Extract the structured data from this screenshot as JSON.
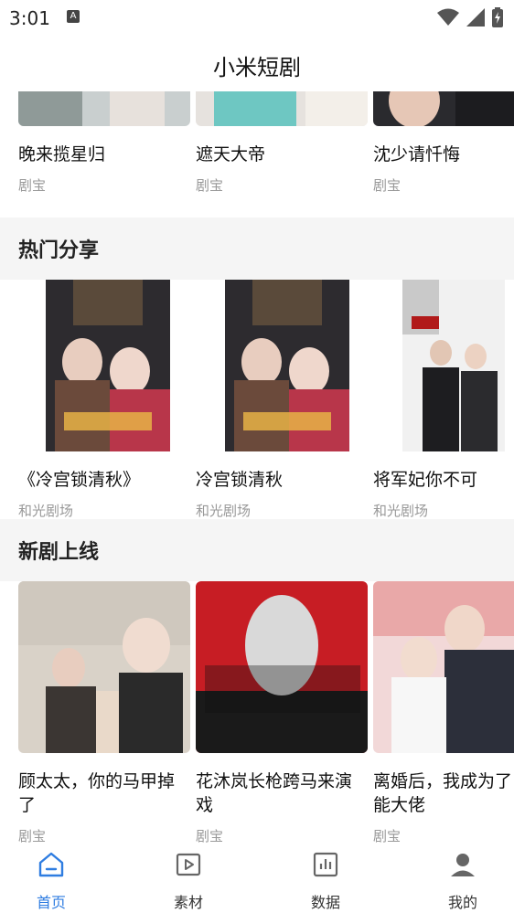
{
  "status_bar": {
    "time": "3:01"
  },
  "header": {
    "title": "小米短剧"
  },
  "top_row": [
    {
      "title": "晚来揽星归",
      "source": "剧宝"
    },
    {
      "title": "遮天大帝",
      "source": "剧宝"
    },
    {
      "title": "沈少请忏悔",
      "source": "剧宝"
    }
  ],
  "hot_share": {
    "title": "热门分享",
    "items": [
      {
        "title": "《冷宫锁清秋》",
        "source": "和光剧场"
      },
      {
        "title": "冷宫锁清秋",
        "source": "和光剧场"
      },
      {
        "title": "将军妃你不可",
        "source": "和光剧场"
      }
    ]
  },
  "new_release": {
    "title": "新剧上线",
    "items": [
      {
        "title_line1": "顾太太，你的马甲掉",
        "title_line2": "了",
        "source": "剧宝"
      },
      {
        "title_line1": "花沐岚长枪跨马来演",
        "title_line2": "戏",
        "source": "剧宝"
      },
      {
        "title_line1": "离婚后，我成为了",
        "title_line2": "能大佬",
        "source": "剧宝"
      }
    ]
  },
  "bottom_nav": [
    {
      "label": "首页",
      "icon": "home-icon",
      "active": true
    },
    {
      "label": "素材",
      "icon": "play-box-icon",
      "active": false
    },
    {
      "label": "数据",
      "icon": "bar-chart-icon",
      "active": false
    },
    {
      "label": "我的",
      "icon": "user-icon",
      "active": false
    }
  ],
  "colors": {
    "accent": "#2f7de1",
    "section_bg": "#f5f5f5",
    "muted": "#999999"
  }
}
